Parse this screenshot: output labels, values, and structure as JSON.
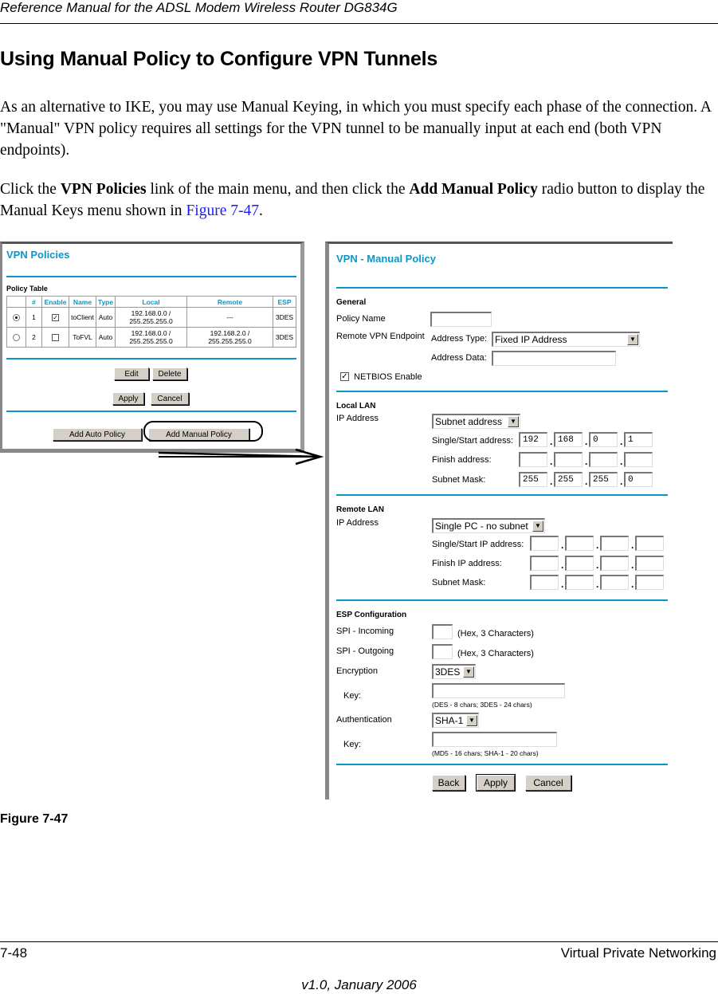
{
  "header": {
    "running_title": "Reference Manual for the ADSL Modem Wireless Router DG834G"
  },
  "section": {
    "title": "Using Manual Policy to Configure VPN Tunnels",
    "para1": "As an alternative to IKE, you may use Manual Keying, in which you must specify each phase of the connection. A \"Manual\" VPN policy requires all settings for the VPN tunnel to be manually input at each end (both VPN endpoints).",
    "para2": {
      "t1": "Click the ",
      "b1": "VPN Policies",
      "t2": " link of the main menu, and then click the ",
      "b2": "Add Manual Policy",
      "t3": " radio button to display the Manual Keys menu shown in ",
      "link": "Figure 7-47",
      "t4": "."
    }
  },
  "vpn_policies": {
    "title": "VPN Policies",
    "table_label": "Policy Table",
    "columns": [
      "",
      "#",
      "Enable",
      "Name",
      "Type",
      "Local",
      "Remote",
      "ESP"
    ],
    "rows": [
      {
        "selected": true,
        "num": "1",
        "enabled": true,
        "name": "toClient",
        "type": "Auto",
        "local1": "192.168.0.0 /",
        "local2": "255.255.255.0",
        "remote1": "---",
        "remote2": "",
        "esp": "3DES"
      },
      {
        "selected": false,
        "num": "2",
        "enabled": false,
        "name": "ToFVL",
        "type": "Auto",
        "local1": "192.168.0.0 /",
        "local2": "255.255.255.0",
        "remote1": "192.168.2.0 /",
        "remote2": "255.255.255.0",
        "esp": "3DES"
      }
    ],
    "buttons": {
      "edit": "Edit",
      "delete": "Delete",
      "apply": "Apply",
      "cancel": "Cancel",
      "add_auto": "Add Auto Policy",
      "add_manual": "Add Manual Policy"
    }
  },
  "manual_policy": {
    "title": "VPN - Manual Policy",
    "general": {
      "label": "General",
      "policy_name_label": "Policy Name",
      "policy_name_value": "",
      "remote_endpoint_label": "Remote VPN Endpoint",
      "address_type_label": "Address Type:",
      "address_type_value": "Fixed IP Address",
      "address_data_label": "Address Data:",
      "address_data_value": "",
      "netbios_label": "NETBIOS Enable",
      "netbios_checked": true
    },
    "local_lan": {
      "label": "Local LAN",
      "ip_label": "IP Address",
      "ip_type": "Subnet address",
      "start_label": "Single/Start address:",
      "start": [
        "192",
        "168",
        "0",
        "1"
      ],
      "finish_label": "Finish address:",
      "finish": [
        "",
        "",
        "",
        ""
      ],
      "mask_label": "Subnet Mask:",
      "mask": [
        "255",
        "255",
        "255",
        "0"
      ]
    },
    "remote_lan": {
      "label": "Remote LAN",
      "ip_label": "IP Address",
      "ip_type": "Single PC - no subnet",
      "start_label": "Single/Start IP address:",
      "start": [
        "",
        "",
        "",
        ""
      ],
      "finish_label": "Finish IP address:",
      "finish": [
        "",
        "",
        "",
        ""
      ],
      "mask_label": "Subnet Mask:",
      "mask": [
        "",
        "",
        "",
        ""
      ]
    },
    "esp": {
      "label": "ESP Configuration",
      "spi_in_label": "SPI - Incoming",
      "spi_in_value": "",
      "spi_out_label": "SPI - Outgoing",
      "spi_out_value": "",
      "hex_hint": "(Hex, 3 Characters)",
      "encryption_label": "Encryption",
      "encryption_value": "3DES",
      "enc_key_label": "Key:",
      "enc_key_value": "",
      "enc_key_hint": "(DES - 8 chars;   3DES - 24 chars)",
      "auth_label": "Authentication",
      "auth_value": "SHA-1",
      "auth_key_label": "Key:",
      "auth_key_value": "",
      "auth_key_hint": "(MD5 - 16 chars;   SHA-1 - 20 chars)"
    },
    "buttons": {
      "back": "Back",
      "apply": "Apply",
      "cancel": "Cancel"
    }
  },
  "figure_caption": "Figure 7-47",
  "footer": {
    "page": "7-48",
    "chapter": "Virtual Private Networking",
    "version": "v1.0, January 2006"
  },
  "colors": {
    "ui_accent": "#0b95c8",
    "link": "#1a1aff"
  }
}
